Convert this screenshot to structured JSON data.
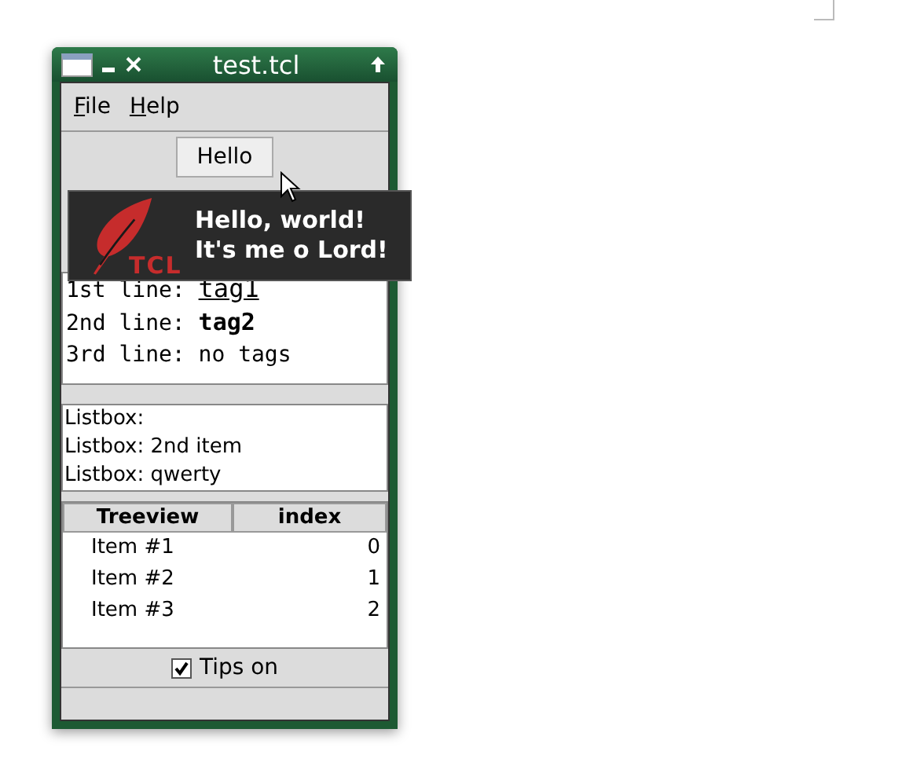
{
  "window": {
    "title": "test.tcl"
  },
  "menu": [
    "File",
    "Help"
  ],
  "hello_button": "Hello",
  "text_lines": [
    {
      "prefix": "1st line: ",
      "tag": "tag1",
      "kind": "underline"
    },
    {
      "prefix": "2nd line: ",
      "tag": "tag2",
      "kind": "bold"
    },
    {
      "prefix": "3rd line: no tags",
      "kind": "plain"
    }
  ],
  "listbox": [
    "Listbox:",
    "Listbox: 2nd item",
    "Listbox: qwerty"
  ],
  "treeview": {
    "columns": [
      "Treeview",
      "index"
    ],
    "rows": [
      [
        "Item #1",
        "0"
      ],
      [
        "Item #2",
        "1"
      ],
      [
        "Item #3",
        "2"
      ]
    ]
  },
  "tips": {
    "label": "Tips on",
    "checked": true
  },
  "tooltip": {
    "logo_text": "TCL",
    "lines": [
      "Hello, world!",
      "It's me o Lord!"
    ]
  }
}
